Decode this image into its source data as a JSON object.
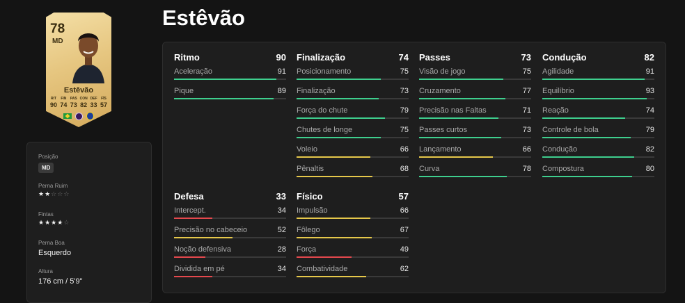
{
  "player": {
    "name": "Estêvão",
    "card": {
      "rating": "78",
      "position": "MD",
      "name": "Estêvão",
      "stats": [
        {
          "label": "RIT",
          "value": "90"
        },
        {
          "label": "FIN",
          "value": "74"
        },
        {
          "label": "PAS",
          "value": "73"
        },
        {
          "label": "CON",
          "value": "82"
        },
        {
          "label": "DEF",
          "value": "33"
        },
        {
          "label": "FÍS",
          "value": "57"
        }
      ],
      "nation_icon": "brazil-flag-icon",
      "league_icon": "premier-league-icon",
      "club_icon": "chelsea-crest-icon"
    },
    "info": {
      "position_label": "Posição",
      "position_value": "MD",
      "weak_foot_label": "Perna Ruim",
      "weak_foot_stars": 2,
      "skill_moves_label": "Fintas",
      "skill_moves_stars": 4,
      "preferred_foot_label": "Perna Boa",
      "preferred_foot_value": "Esquerdo",
      "height_label": "Altura",
      "height_value": "176 cm / 5'9\""
    }
  },
  "bar_colors": {
    "high": "#3ecf8e",
    "mid": "#e6c84a",
    "low": "#e5484d"
  },
  "groups": [
    {
      "name": "Ritmo",
      "value": 90,
      "attributes": [
        {
          "name": "Aceleração",
          "value": 91
        },
        {
          "name": "Pique",
          "value": 89
        }
      ]
    },
    {
      "name": "Finalização",
      "value": 74,
      "attributes": [
        {
          "name": "Posicionamento",
          "value": 75
        },
        {
          "name": "Finalização",
          "value": 73
        },
        {
          "name": "Força do chute",
          "value": 79
        },
        {
          "name": "Chutes de longe",
          "value": 75
        },
        {
          "name": "Voleio",
          "value": 66
        },
        {
          "name": "Pênaltis",
          "value": 68
        }
      ]
    },
    {
      "name": "Passes",
      "value": 73,
      "attributes": [
        {
          "name": "Visão de jogo",
          "value": 75
        },
        {
          "name": "Cruzamento",
          "value": 77
        },
        {
          "name": "Precisão nas Faltas",
          "value": 71
        },
        {
          "name": "Passes curtos",
          "value": 73
        },
        {
          "name": "Lançamento",
          "value": 66
        },
        {
          "name": "Curva",
          "value": 78
        }
      ]
    },
    {
      "name": "Condução",
      "value": 82,
      "attributes": [
        {
          "name": "Agilidade",
          "value": 91
        },
        {
          "name": "Equilíbrio",
          "value": 93
        },
        {
          "name": "Reação",
          "value": 74
        },
        {
          "name": "Controle de bola",
          "value": 79
        },
        {
          "name": "Condução",
          "value": 82
        },
        {
          "name": "Compostura",
          "value": 80
        }
      ]
    },
    {
      "name": "Defesa",
      "value": 33,
      "attributes": [
        {
          "name": "Intercept.",
          "value": 34
        },
        {
          "name": "Precisão no cabeceio",
          "value": 52
        },
        {
          "name": "Noção defensiva",
          "value": 28
        },
        {
          "name": "Dividida em pé",
          "value": 34
        }
      ]
    },
    {
      "name": "Físico",
      "value": 57,
      "attributes": [
        {
          "name": "Impulsão",
          "value": 66
        },
        {
          "name": "Fôlego",
          "value": 67
        },
        {
          "name": "Força",
          "value": 49
        },
        {
          "name": "Combatividade",
          "value": 62
        }
      ]
    }
  ]
}
